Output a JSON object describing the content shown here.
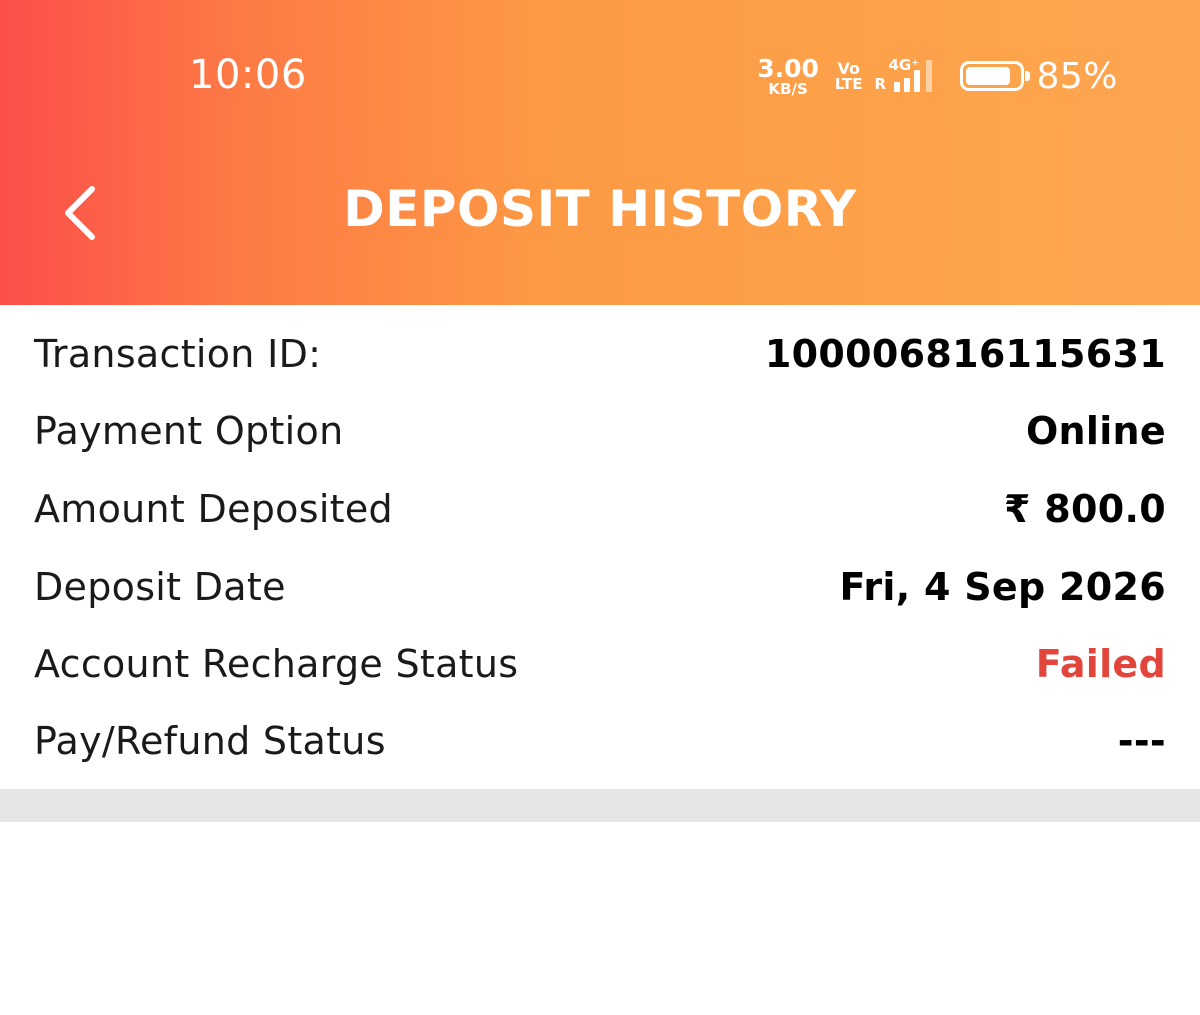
{
  "status_bar": {
    "time": "10:06",
    "net_speed_value": "3.00",
    "net_speed_unit": "KB/S",
    "volte_top": "Vo",
    "volte_bottom": "LTE",
    "network_type": "4G⁺",
    "roaming": "R",
    "battery_percent": "85%",
    "battery_level": 0.85,
    "signal_bars_filled": 3,
    "signal_bars_total": 4
  },
  "header": {
    "title": "DEPOSIT HISTORY",
    "back_icon": "chevron-left-icon",
    "gradient_start": "#fc4e4a",
    "gradient_end": "#fda650"
  },
  "details": {
    "rows": [
      {
        "label": "Transaction ID:",
        "value": "100006816115631"
      },
      {
        "label": "Payment Option",
        "value": "Online"
      },
      {
        "label": "Amount Deposited",
        "value": "₹ 800.0"
      },
      {
        "label": "Deposit Date",
        "value": "Fri, 4 Sep 2026"
      },
      {
        "label": "Account Recharge Status",
        "value": "Failed"
      },
      {
        "label": "Pay/Refund Status",
        "value": "---"
      }
    ],
    "failed_color": "#e2453c"
  }
}
